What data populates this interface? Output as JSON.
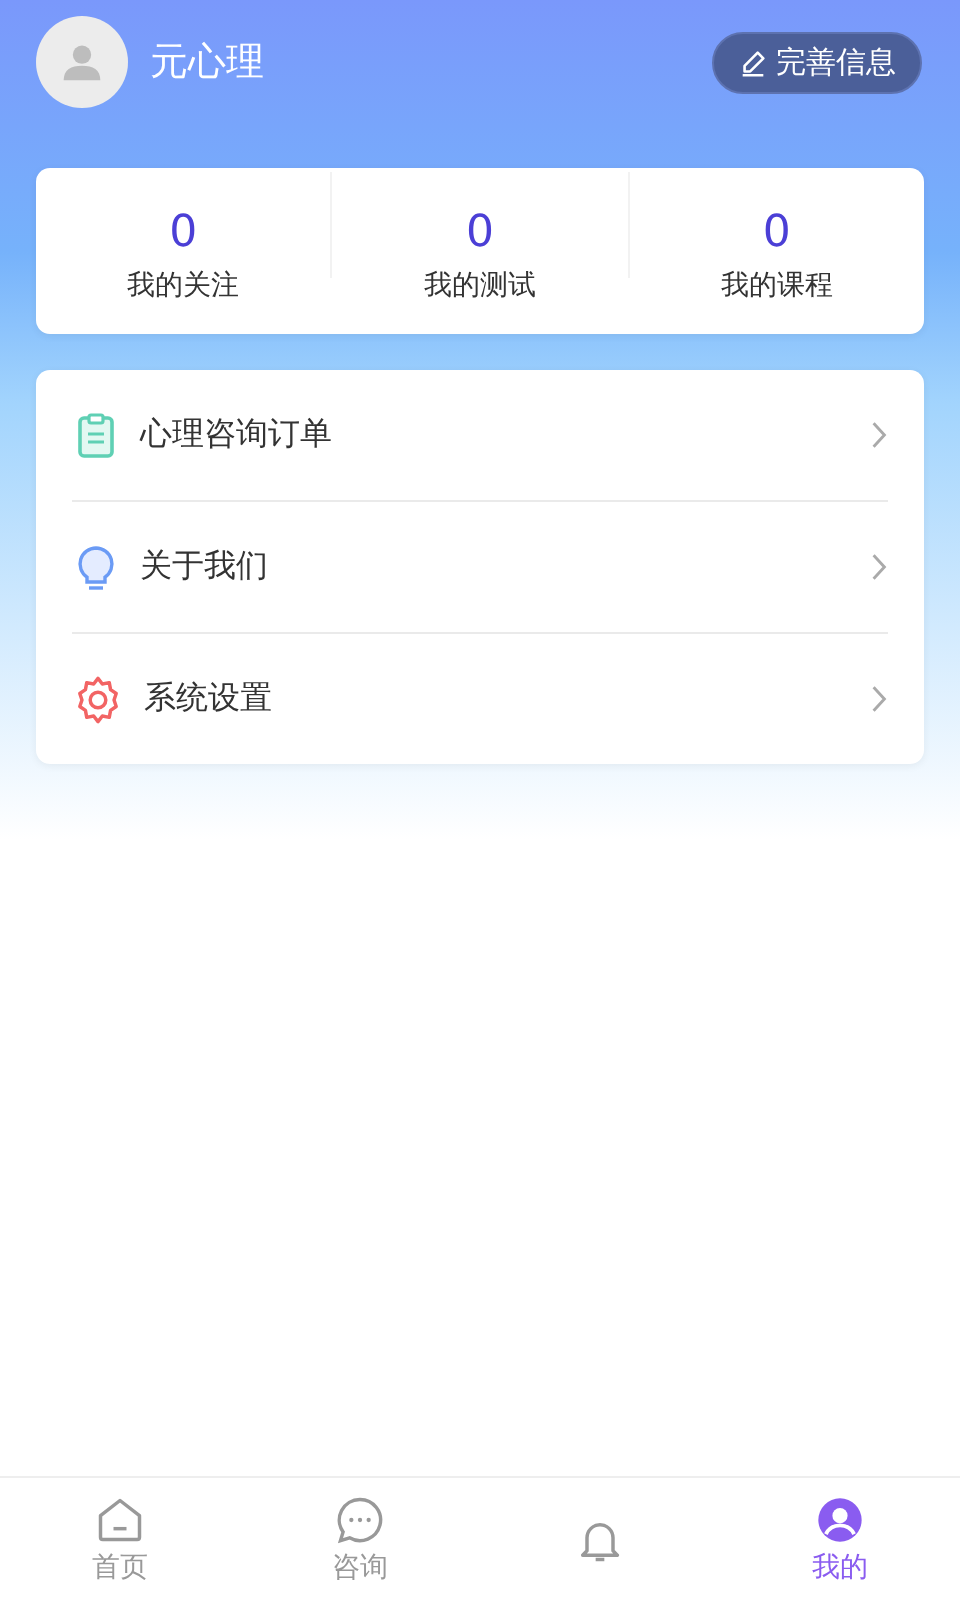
{
  "profile": {
    "name": "元心理",
    "edit_button": "完善信息"
  },
  "stats": [
    {
      "value": "0",
      "label": "我的关注"
    },
    {
      "value": "0",
      "label": "我的测试"
    },
    {
      "value": "0",
      "label": "我的课程"
    }
  ],
  "menu": [
    {
      "kind": "order",
      "label": "心理咨询订单"
    },
    {
      "kind": "about",
      "label": "关于我们"
    },
    {
      "kind": "settings",
      "label": "系统设置"
    }
  ],
  "tab_bar": [
    {
      "kind": "home",
      "label": "首页",
      "selected": false
    },
    {
      "kind": "chat",
      "label": "咨询",
      "selected": false
    },
    {
      "kind": "bell",
      "selected": false
    },
    {
      "kind": "profile",
      "label": "我的",
      "selected": true
    }
  ]
}
